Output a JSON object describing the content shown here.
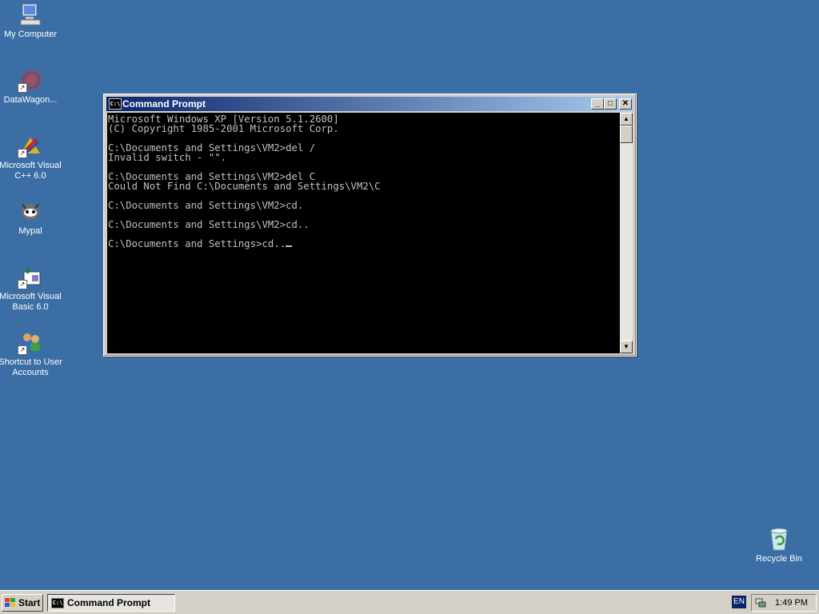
{
  "desktop": {
    "icons": [
      {
        "label": "My Computer",
        "icon": "my-computer-icon"
      },
      {
        "label": "DataWagon...",
        "icon": "datawagon-icon"
      },
      {
        "label": "Microsoft Visual C++ 6.0",
        "icon": "visual-cpp-icon"
      },
      {
        "label": "Mypal",
        "icon": "mypal-icon"
      },
      {
        "label": "Microsoft Visual Basic 6.0",
        "icon": "visual-basic-icon"
      },
      {
        "label": "Shortcut to User Accounts",
        "icon": "user-accounts-icon"
      },
      {
        "label": "Recycle Bin",
        "icon": "recycle-bin-icon"
      }
    ],
    "background_color": "#3a6ea5"
  },
  "window": {
    "title": "Command Prompt",
    "minimize": "_",
    "maximize": "□",
    "close": "✕",
    "console_lines": [
      "Microsoft Windows XP [Version 5.1.2600]",
      "(C) Copyright 1985-2001 Microsoft Corp.",
      "",
      "C:\\Documents and Settings\\VM2>del /",
      "Invalid switch - \"\".",
      "",
      "C:\\Documents and Settings\\VM2>del C",
      "Could Not Find C:\\Documents and Settings\\VM2\\C",
      "",
      "C:\\Documents and Settings\\VM2>cd.",
      "",
      "C:\\Documents and Settings\\VM2>cd..",
      "",
      "C:\\Documents and Settings>cd.."
    ]
  },
  "taskbar": {
    "start_label": "Start",
    "task_label": "Command Prompt",
    "language": "EN",
    "clock": "1:49 PM"
  }
}
